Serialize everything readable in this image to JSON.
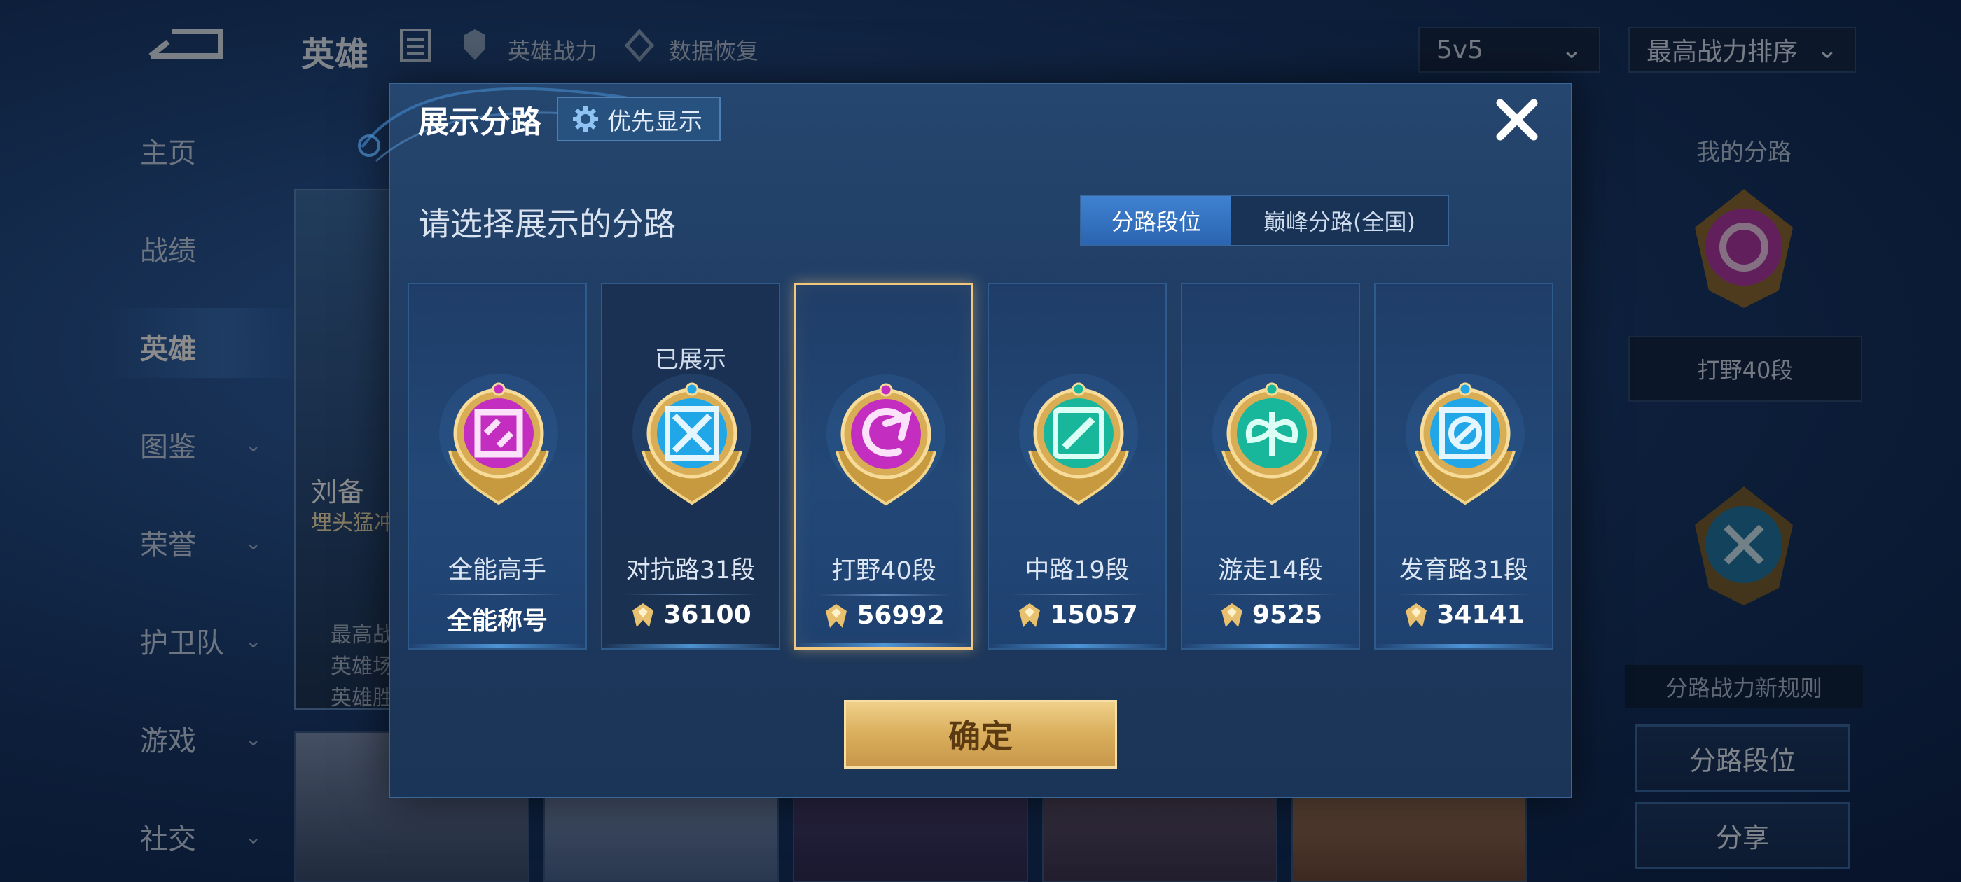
{
  "background": {
    "topbar": {
      "title": "英雄",
      "link_power": "英雄战力",
      "link_restore": "数据恢复",
      "mode_select": "5v5",
      "sort_select": "最高战力排序"
    },
    "nav": [
      "主页",
      "战绩",
      "英雄",
      "图鉴",
      "荣誉",
      "护卫队",
      "游戏",
      "社交"
    ],
    "nav_active": "英雄",
    "hero_card": {
      "name": "刘备",
      "subtitle": "埋头猛冲",
      "info": [
        "最高战",
        "英雄场",
        "英雄胜"
      ]
    },
    "right_panel": {
      "title": "我的分路",
      "field_value": "打野40段",
      "rule_text": "分路战力新规则",
      "lane_rank_button": "分路段位",
      "share_button": "分享"
    }
  },
  "modal": {
    "title": "展示分路",
    "priority_button": "优先显示",
    "subtitle": "请选择展示的分路",
    "toggle": {
      "active": "分路段位",
      "inactive": "巅峰分路(全国)"
    },
    "lanes": [
      {
        "label": "全能高手",
        "value": "全能称号",
        "has_icon": false,
        "shown": "",
        "color": "#c42ec0",
        "glyph": "allround"
      },
      {
        "label": "对抗路31段",
        "value": "36100",
        "has_icon": true,
        "shown": "已展示",
        "color": "#21a7e8",
        "glyph": "clash"
      },
      {
        "label": "打野40段",
        "value": "56992",
        "has_icon": true,
        "shown": "",
        "color": "#c42ec0",
        "glyph": "jungle",
        "selected": true
      },
      {
        "label": "中路19段",
        "value": "15057",
        "has_icon": true,
        "shown": "",
        "color": "#18b79b",
        "glyph": "mid"
      },
      {
        "label": "游走14段",
        "value": "9525",
        "has_icon": true,
        "shown": "",
        "color": "#18b79b",
        "glyph": "roam"
      },
      {
        "label": "发育路31段",
        "value": "34141",
        "has_icon": true,
        "shown": "",
        "color": "#21a7e8",
        "glyph": "farm"
      }
    ],
    "confirm_button": "确定"
  }
}
